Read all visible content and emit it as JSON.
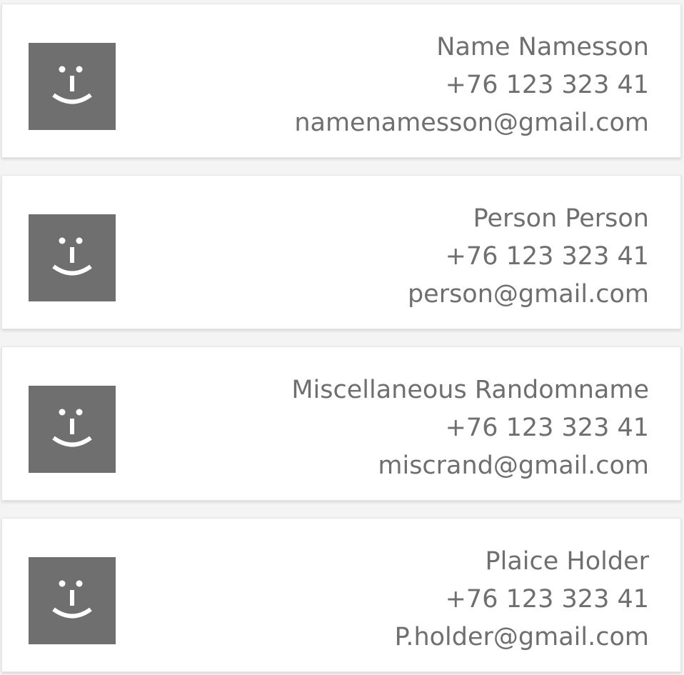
{
  "contacts": [
    {
      "name": "Name Namesson",
      "phone": "+76 123 323 41",
      "email": "namenamesson@gmail.com",
      "avatar_icon": "smiley-icon"
    },
    {
      "name": "Person Person",
      "phone": "+76 123 323 41",
      "email": "person@gmail.com",
      "avatar_icon": "smiley-icon"
    },
    {
      "name": "Miscellaneous Randomname",
      "phone": "+76 123 323 41",
      "email": "miscrand@gmail.com",
      "avatar_icon": "smiley-icon"
    },
    {
      "name": "Plaice Holder",
      "phone": "+76 123 323 41",
      "email": "P.holder@gmail.com",
      "avatar_icon": "smiley-icon"
    }
  ],
  "colors": {
    "card_background": "#ffffff",
    "page_background": "#f4f4f4",
    "avatar_background": "#6f6f6f",
    "text": "#6f6f6f"
  }
}
